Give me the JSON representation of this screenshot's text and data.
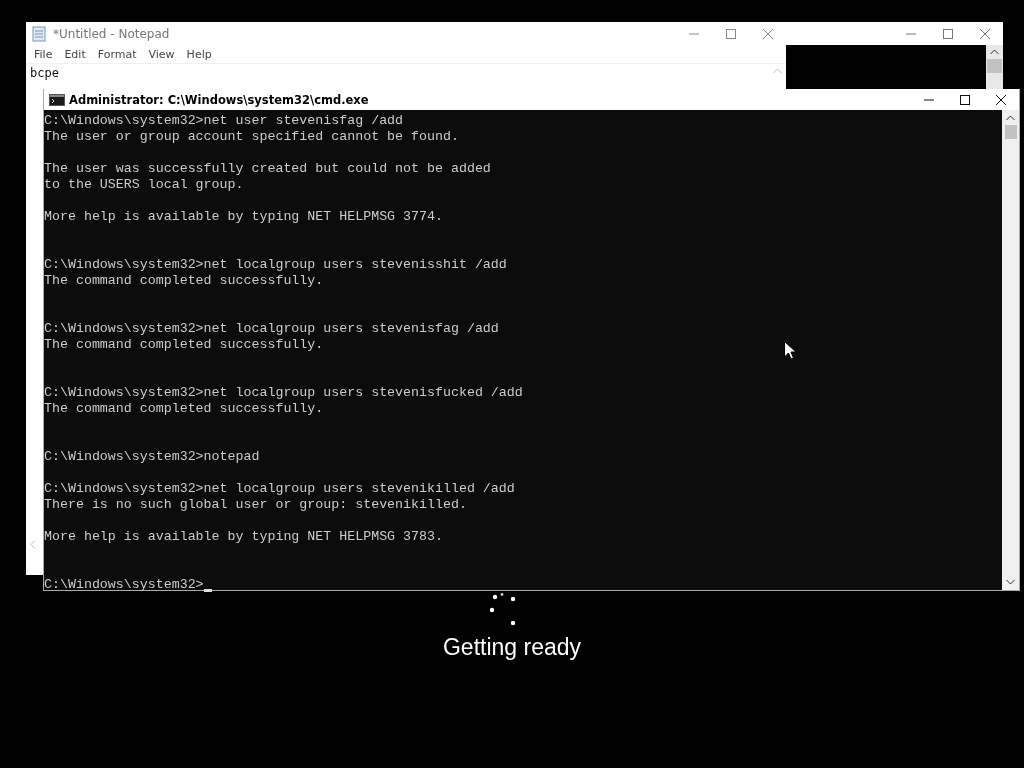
{
  "notepad": {
    "title": "*Untitled - Notepad",
    "menu": [
      "File",
      "Edit",
      "Format",
      "View",
      "Help"
    ],
    "content": "bcpe"
  },
  "background_window": {
    "kind": "window"
  },
  "cmd": {
    "title": "Administrator: C:\\Windows\\system32\\cmd.exe",
    "lines": [
      {
        "kind": "text",
        "text": "C:\\Windows\\system32>net user stevenisfag /add"
      },
      {
        "kind": "text",
        "text": "The user or group account specified cannot be found."
      },
      {
        "kind": "blank"
      },
      {
        "kind": "text",
        "text": "The user was successfully created but could not be added"
      },
      {
        "kind": "text",
        "text": "to the USERS local group."
      },
      {
        "kind": "blank"
      },
      {
        "kind": "text",
        "text": "More help is available by typing NET HELPMSG 3774."
      },
      {
        "kind": "blank"
      },
      {
        "kind": "blank"
      },
      {
        "kind": "text",
        "text": "C:\\Windows\\system32>net localgroup users stevenisshit /add"
      },
      {
        "kind": "text",
        "text": "The command completed successfully."
      },
      {
        "kind": "blank"
      },
      {
        "kind": "blank"
      },
      {
        "kind": "text",
        "text": "C:\\Windows\\system32>net localgroup users stevenisfag /add"
      },
      {
        "kind": "text",
        "text": "The command completed successfully."
      },
      {
        "kind": "blank"
      },
      {
        "kind": "blank"
      },
      {
        "kind": "text",
        "text": "C:\\Windows\\system32>net localgroup users stevenisfucked /add"
      },
      {
        "kind": "text",
        "text": "The command completed successfully."
      },
      {
        "kind": "blank"
      },
      {
        "kind": "blank"
      },
      {
        "kind": "text",
        "text": "C:\\Windows\\system32>notepad"
      },
      {
        "kind": "blank"
      },
      {
        "kind": "text",
        "text": "C:\\Windows\\system32>net localgroup users stevenikilled /add"
      },
      {
        "kind": "text",
        "text": "There is no such global user or group: stevenikilled."
      },
      {
        "kind": "blank"
      },
      {
        "kind": "text",
        "text": "More help is available by typing NET HELPMSG 3783."
      },
      {
        "kind": "blank"
      },
      {
        "kind": "blank"
      },
      {
        "kind": "prompt",
        "text": "C:\\Windows\\system32>"
      }
    ]
  },
  "status": {
    "message": "Getting ready"
  }
}
